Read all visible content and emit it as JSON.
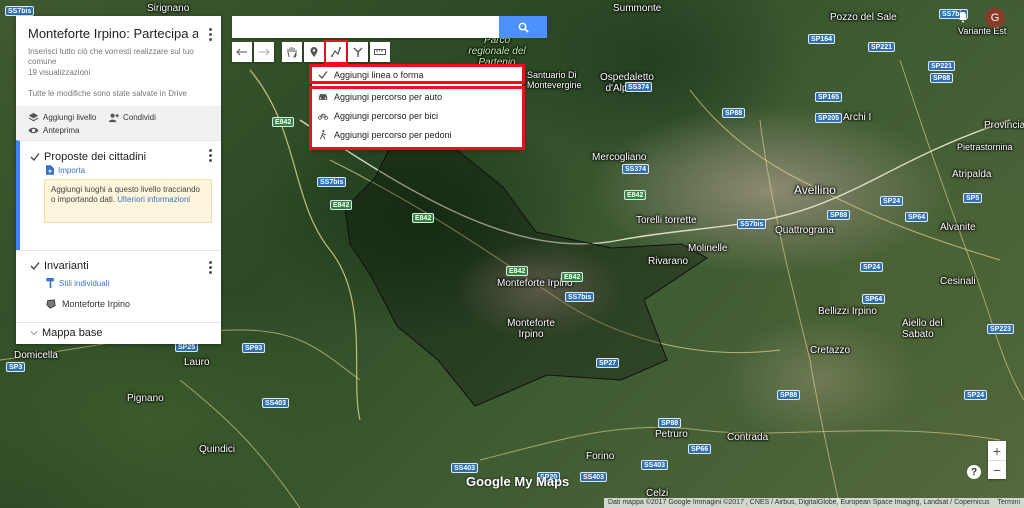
{
  "map": {
    "places": [
      "Summonte",
      "Pozzo del Sale",
      "Sirignano",
      "Ospedaletto d'Alpinolo",
      "Archi I",
      "Provincia",
      "Pietrastornina",
      "Avellino",
      "Atripalda",
      "Mercogliano",
      "Torelli torrette",
      "Quattrograna",
      "Alvanite",
      "Molinelle",
      "Rivarano",
      "Monteforte Irpino",
      "Monteforte Irpino",
      "Cesinali",
      "Bellizzi Irpino",
      "Aiello del Sabato",
      "Cretazzo",
      "Lauro",
      "Domicella",
      "Pignano",
      "Contrada",
      "Petruro",
      "Quindici",
      "Forino",
      "Celzi",
      "Parco regionale del Partenio",
      "Santuario Di Montevergine",
      "Variante Est"
    ],
    "roads": [
      "SS7bis",
      "SS7bis",
      "SP164",
      "SP221",
      "SP221",
      "SP88",
      "SS374",
      "SS374",
      "SP165",
      "SP205",
      "E842",
      "E842",
      "E842",
      "SS7bis",
      "SP88",
      "SP24",
      "SP64",
      "E842",
      "SP5",
      "SP88",
      "SP24",
      "SP64",
      "SP88",
      "SP24",
      "SP223",
      "SS7bis",
      "SP3",
      "SP25",
      "SP93",
      "SS403",
      "SS403",
      "SS403",
      "SP88",
      "SP66",
      "SS403",
      "E842",
      "SS7bis",
      "SP27",
      "E842",
      "SP20"
    ]
  },
  "panel": {
    "title": "Monteforte Irpino: Partecipa al P...",
    "description": "Inserisci tutto ciò che vorresti realizzare sul tuo comune",
    "views": "19 visualizzazioni",
    "saved": "Tutte le modifiche sono state salvate in Drive",
    "add_layer": "Aggiungi livello",
    "share": "Condividi",
    "preview": "Anteprima",
    "layers": [
      {
        "name": "Proposte dei cittadini",
        "import": "Importa",
        "hint_text": "Aggiungi luoghi a questo livello tracciando o importando dati.",
        "hint_link": "Ulteriori informazioni"
      },
      {
        "name": "Invarianti",
        "styles": "Stili individuali",
        "item": "Monteforte Irpino"
      }
    ],
    "basemap": "Mappa base"
  },
  "search": {
    "value": "",
    "placeholder": ""
  },
  "menu": {
    "items": [
      "Aggiungi linea o forma",
      "Aggiungi percorso per auto",
      "Aggiungi percorso per bici",
      "Aggiungi percorso per pedoni"
    ]
  },
  "user": {
    "avatar_letter": "G"
  },
  "zoom": {
    "in": "+",
    "out": "−"
  },
  "help": "?",
  "brand": "Google My Maps",
  "attribution": {
    "data": "Dati mappa ©2017 Google Immagini ©2017 , CNES / Airbus, DigitalGlobe, European Space Imaging, Landsat / Copernicus",
    "terms": "Termini"
  },
  "colors": {
    "accent": "#4285f4",
    "highlight": "#e8121c",
    "search_button": "#4d90fe"
  }
}
